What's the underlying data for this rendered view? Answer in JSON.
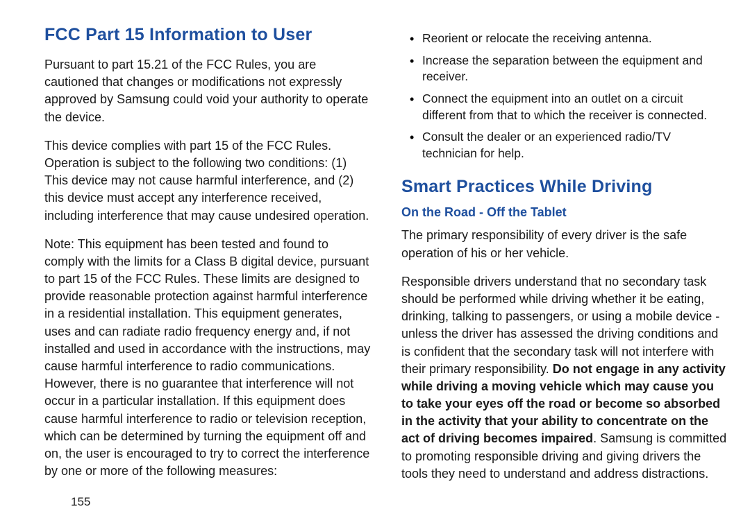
{
  "left": {
    "heading": "FCC Part 15 Information to User",
    "p1": "Pursuant to part 15.21 of the FCC Rules, you are cautioned that changes or modifications not expressly approved by Samsung could void your authority to operate the device.",
    "p2": "This device complies with part 15 of the FCC Rules. Operation is subject to the following two conditions: (1) This device may not cause harmful interference, and (2) this device must accept any interference received, including interference that may cause undesired operation.",
    "p3": "Note: This equipment has been tested and found to comply with the limits for a Class B digital device, pursuant to part 15 of the FCC Rules. These limits are designed to provide reasonable protection against harmful interference in a residential installation. This equipment generates, uses and can radiate radio frequency energy and, if not installed and used in accordance with the instructions, may cause harmful interference to radio communications. However, there is no guarantee that interference will not occur in a particular installation. If this equipment does cause harmful interference to radio or television reception, which can be determined by turning the equipment off and on, the user is encouraged to try to correct the interference by one or more of the following measures:",
    "page_num": "155"
  },
  "right": {
    "bullets": [
      "Reorient or relocate the receiving antenna.",
      "Increase the separation between the equipment and receiver.",
      "Connect the equipment into an outlet on a circuit different from that to which the receiver is connected.",
      "Consult the dealer or an experienced radio/TV technician for help."
    ],
    "heading2": "Smart Practices While Driving",
    "subhead": "On the Road - Off the Tablet",
    "p4": "The primary responsibility of every driver is the safe operation of his or her vehicle.",
    "p5_plain1": "Responsible drivers understand that no secondary task should be performed while driving whether it be eating, drinking, talking to passengers, or using a mobile device - unless the driver has assessed the driving conditions and is confident that the secondary task will not interfere with their primary responsibility. ",
    "p5_bold": "Do not engage in any activity while driving a moving vehicle which may cause you to take your eyes off the road or become so absorbed in the activity that your ability to concentrate on the act of driving becomes impaired",
    "p5_plain2": ". Samsung is committed to promoting responsible driving and giving drivers the tools they need to understand and address distractions."
  }
}
